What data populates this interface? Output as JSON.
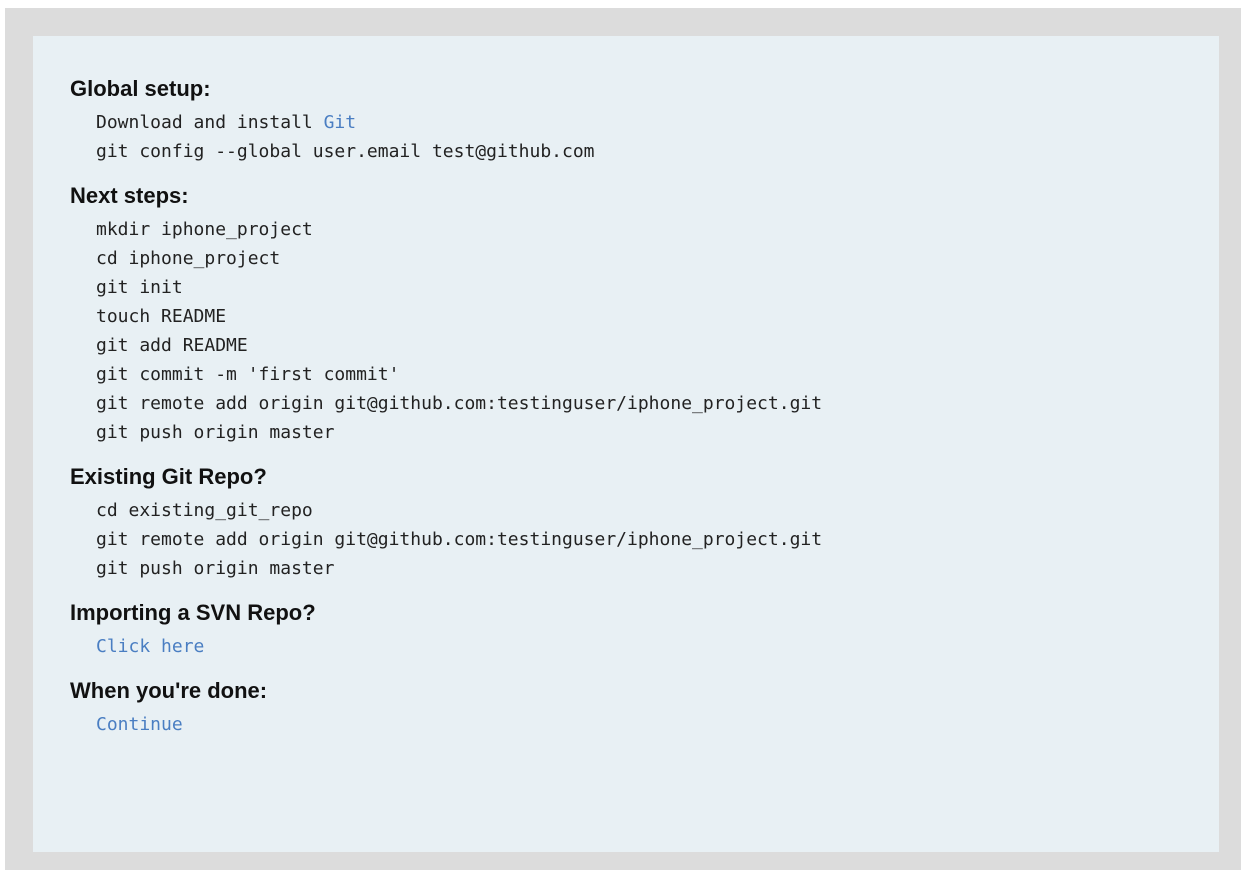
{
  "sections": {
    "global_setup": {
      "title": "Global setup:",
      "download_text": "Download and install ",
      "download_link": "Git",
      "config_command": "git config --global user.email test@github.com"
    },
    "next_steps": {
      "title": "Next steps:",
      "commands": [
        "mkdir iphone_project",
        "cd iphone_project",
        "git init",
        "touch README",
        "git add README",
        "git commit -m 'first commit'",
        "git remote add origin git@github.com:testinguser/iphone_project.git",
        "git push origin master"
      ]
    },
    "existing_repo": {
      "title": "Existing Git Repo?",
      "commands": [
        "cd existing_git_repo",
        "git remote add origin git@github.com:testinguser/iphone_project.git",
        "git push origin master"
      ]
    },
    "import_svn": {
      "title": "Importing a SVN Repo?",
      "link": "Click here"
    },
    "done": {
      "title": "When you're done:",
      "link": "Continue"
    }
  },
  "colors": {
    "link": "#4a7ec2",
    "panel_bg": "#e8f0f4",
    "frame_bg": "#dcdcdc"
  }
}
